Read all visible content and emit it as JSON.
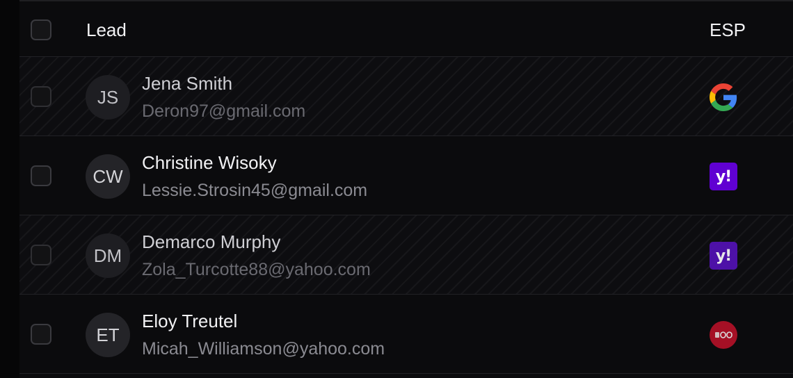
{
  "table": {
    "columns": {
      "lead": "Lead",
      "esp": "ESP"
    },
    "rows": [
      {
        "initials": "JS",
        "name": "Jena Smith",
        "email": "Deron97@gmail.com",
        "esp": "google-icon",
        "striped": true
      },
      {
        "initials": "CW",
        "name": "Christine Wisoky",
        "email": "Lessie.Strosin45@gmail.com",
        "esp": "yahoo-icon",
        "esp_text": "y!",
        "striped": false
      },
      {
        "initials": "DM",
        "name": "Demarco Murphy",
        "email": "Zola_Turcotte88@yahoo.com",
        "esp": "yahoo-icon",
        "esp_text": "y!",
        "striped": true
      },
      {
        "initials": "ET",
        "name": "Eloy Treutel",
        "email": "Micah_Williamson@yahoo.com",
        "esp": "other-esp-icon",
        "esp_text": "",
        "striped": false
      }
    ]
  },
  "colors": {
    "background": "#0b0b0d",
    "yahoo_purple": "#6001d2",
    "google_blue": "#4285f4",
    "google_red": "#ea4335",
    "google_yellow": "#fbbc05",
    "google_green": "#34a853",
    "other_esp_red": "#c0122a"
  }
}
